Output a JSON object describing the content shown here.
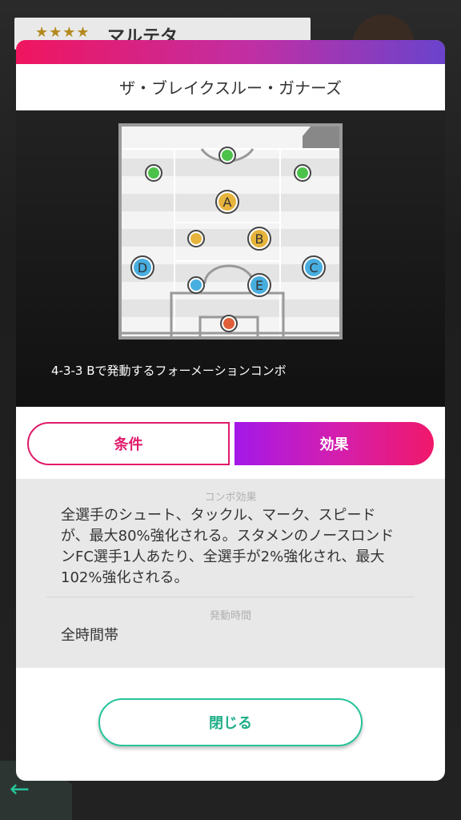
{
  "background": {
    "stars": "★★★★",
    "name": "マルテタ",
    "back_arrow": "←"
  },
  "modal": {
    "title": "ザ・ブレイクスルー・ガナーズ",
    "formation_description": "4-3-3 Bで発動するフォーメーションコンボ",
    "pitch_markers": {
      "a": "A",
      "b": "B",
      "c": "C",
      "d": "D",
      "e": "E"
    },
    "tabs": {
      "conditions": "条件",
      "effects": "効果"
    },
    "combo_effect_label": "コンボ効果",
    "combo_effect_text": "全選手のシュート、タックル、マーク、スピードが、最大80%強化される。スタメンのノースロンドンFC選手1人あたり、全選手が2%強化され、最大102%強化される。",
    "active_time_label": "発動時間",
    "active_time_text": "全時間帯",
    "close_label": "閉じる"
  },
  "colors": {
    "accent_pink": "#f0155f",
    "accent_purple": "#6a43cc",
    "close_green": "#26c49a",
    "player_green": "#4cc24a",
    "player_yellow": "#e6b43c",
    "player_blue": "#48aee0"
  }
}
